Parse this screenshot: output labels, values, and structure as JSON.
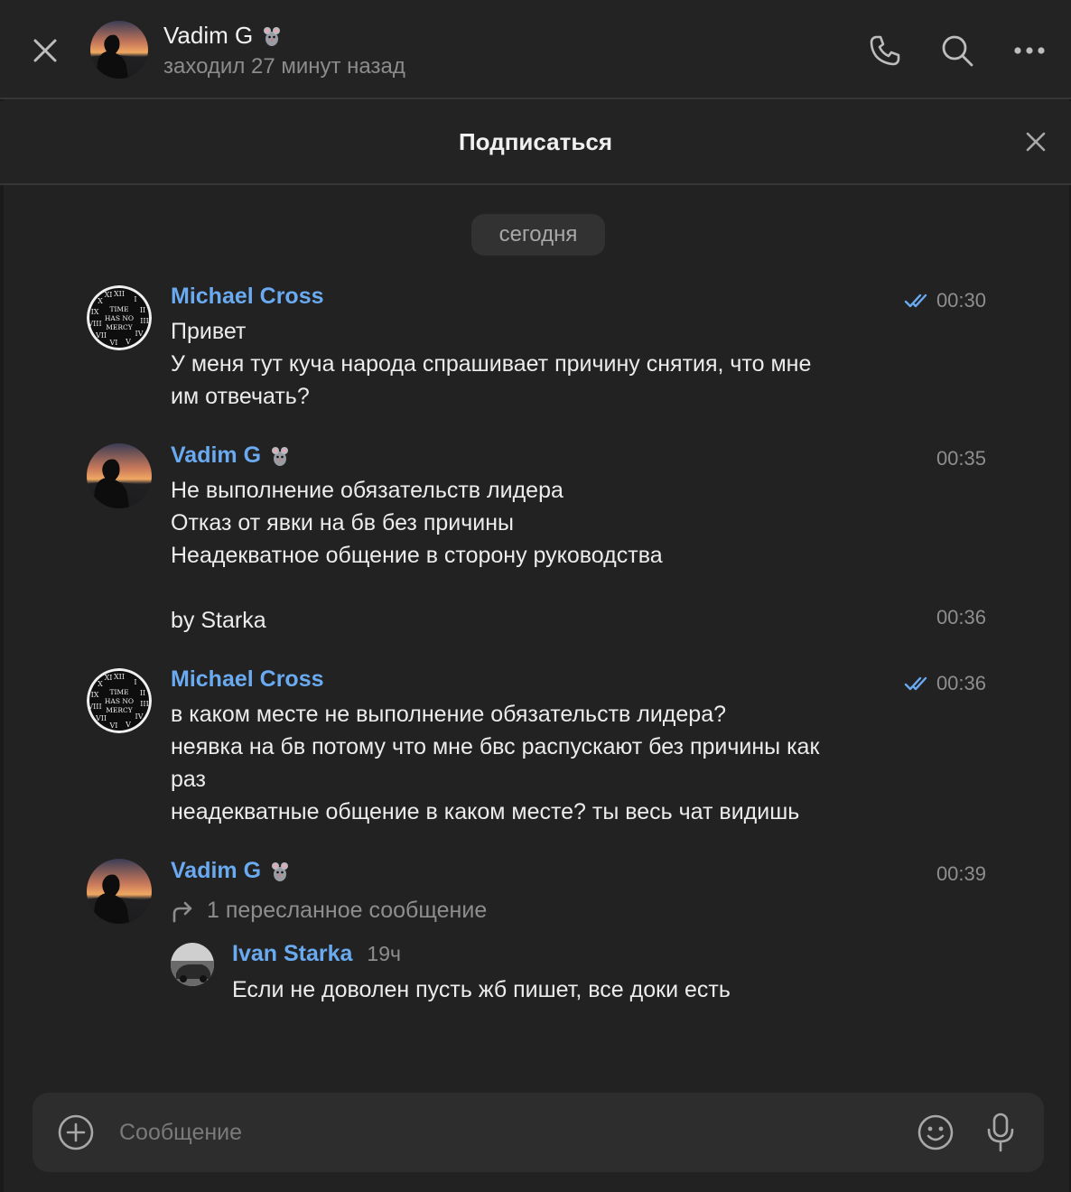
{
  "header": {
    "name": "Vadim G",
    "status": "заходил 27 минут назад"
  },
  "subscribe": {
    "label": "Подписаться"
  },
  "date_label": "сегодня",
  "messages": [
    {
      "sender": "Michael Cross",
      "text": "Привет\nУ меня тут куча народа спрашивает причину снятия, что мне\nим отвечать?",
      "time": "00:30",
      "read": true
    },
    {
      "sender": "Vadim G",
      "text": "Не выполнение обязательств лидера\nОтказ от явки на бв без причины\nНеадекватное общение в сторону руководства",
      "time": "00:35"
    },
    {
      "text": "by Starka",
      "time": "00:36"
    },
    {
      "sender": "Michael Cross",
      "text": "в каком месте не выполнение обязательств лидера?\nнеявка на бв потому что мне бвс распускают без причины как\nраз\nнеадекватные общение в каком месте? ты весь чат видишь",
      "time": "00:36",
      "read": true
    },
    {
      "sender": "Vadim G",
      "time": "00:39",
      "forward_label": "1 пересланное сообщение",
      "forwarded": {
        "sender": "Ivan Starka",
        "ago": "19ч",
        "text": "Если не доволен пусть жб пишет, все доки есть"
      }
    }
  ],
  "composer": {
    "placeholder": "Сообщение"
  },
  "colors": {
    "accent": "#69aaf0",
    "background": "#222222",
    "muted": "#8e8e8e"
  },
  "icons": [
    "close-icon",
    "phone-icon",
    "search-icon",
    "more-icon",
    "read-check-icon",
    "forward-icon",
    "attach-plus-icon",
    "emoji-icon",
    "microphone-icon",
    "rat-emoji"
  ]
}
